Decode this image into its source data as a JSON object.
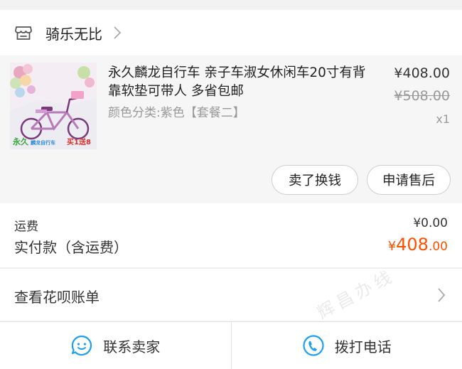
{
  "shop": {
    "name": "骑乐无比"
  },
  "item": {
    "title": "永久麟龙自行车 亲子车淑女休闲车20寸有背靠软垫可带人 多省包邮",
    "spec": "颜色分类:紫色【套餐二】",
    "price": "¥408.00",
    "original_price": "¥508.00",
    "quantity": "x1",
    "thumb_brand": "永久",
    "thumb_sub": "麟龙自行车",
    "thumb_promo": "买1送8"
  },
  "actions": {
    "sell": "卖了换钱",
    "after_sale": "申请售后"
  },
  "summary": {
    "shipping_label": "运费",
    "shipping_value": "¥0.00",
    "paid_label": "实付款（含运费）",
    "paid_currency": "¥",
    "paid_int": "408",
    "paid_dec": ".00"
  },
  "bill": {
    "label": "查看花呗账单",
    "watermark": "辉昌办线"
  },
  "bottom": {
    "contact": "联系卖家",
    "call": "拨打电话"
  },
  "colors": {
    "accent": "#ff5000",
    "icon_blue": "#1ea0f0"
  }
}
